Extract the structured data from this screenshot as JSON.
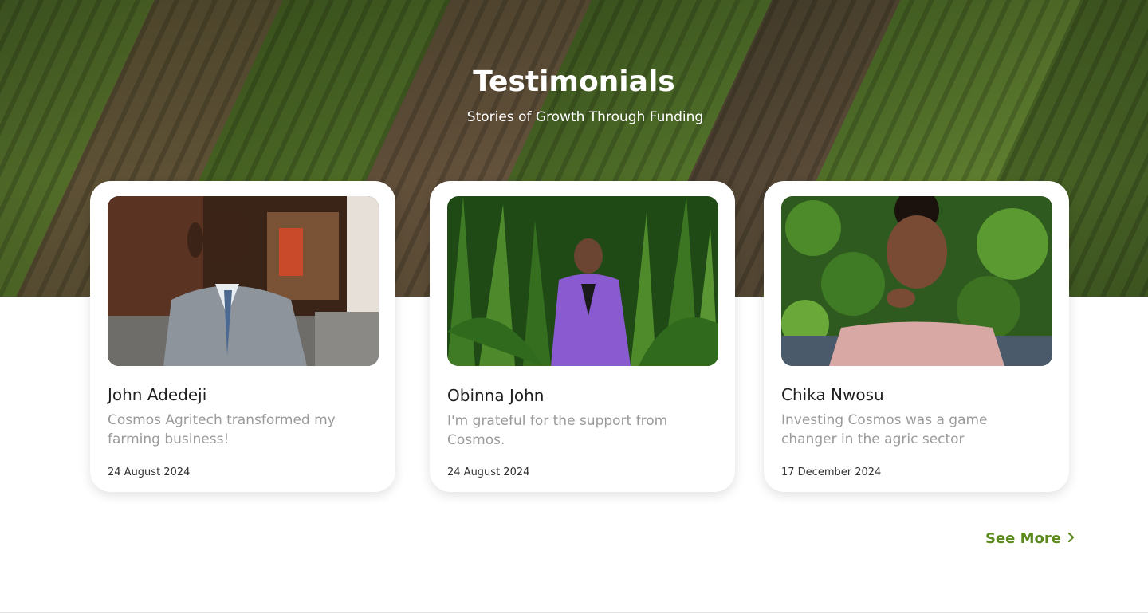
{
  "section": {
    "title": "Testimonials",
    "subtitle": "Stories of Growth Through Funding"
  },
  "testimonials": [
    {
      "name": "John Adedeji",
      "quote": "Cosmos Agritech transformed my farming business!",
      "date": "24 August 2024"
    },
    {
      "name": "Obinna John",
      "quote": "I'm grateful for the support from Cosmos.",
      "date": "24 August 2024"
    },
    {
      "name": "Chika Nwosu",
      "quote": "Investing Cosmos was a game changer in the agric sector",
      "date": "17 December 2024"
    }
  ],
  "see_more": {
    "label": "See More",
    "icon": "chevron-right-icon"
  },
  "colors": {
    "accent": "#5d8a1e",
    "quote_text": "#9a9a9a"
  }
}
